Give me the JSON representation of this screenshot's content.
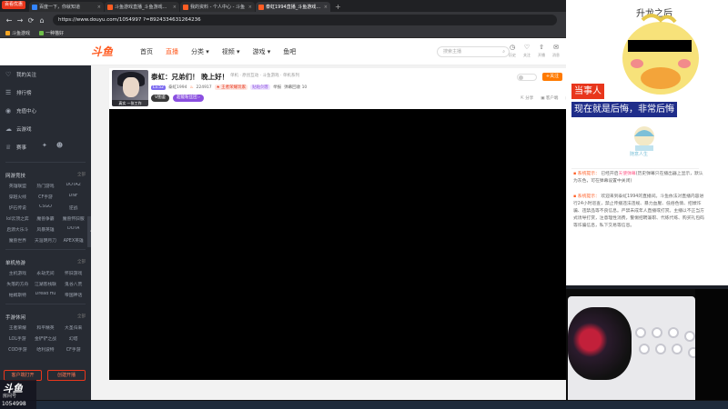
{
  "browser": {
    "badge": "百看优惠",
    "tabs": [
      {
        "label": "百度一下，你就知道",
        "color": "#3385ff",
        "active": false
      },
      {
        "label": "斗鱼游戏直播_斗鱼游戏原创",
        "color": "#ff5d23",
        "active": false
      },
      {
        "label": "我的资料 - 个人中心 - 斗鱼",
        "color": "#ff5d23",
        "active": false
      },
      {
        "label": "泰虹1994直播_斗鱼游戏原创",
        "color": "#ff5d23",
        "active": true
      }
    ],
    "new_tab": "+",
    "nav": {
      "back": "←",
      "forward": "→",
      "refresh": "⟳",
      "home": "⌂"
    },
    "url": "https://www.douyu.com/1054997 ?=8924334631264236",
    "bookmarks": [
      "斗鱼游戏",
      "一种猫好"
    ]
  },
  "site": {
    "logo": "斗鱼",
    "nav": [
      "首页",
      "直播",
      "分类 ▾",
      "视频 ▾",
      "游戏 ▾",
      "鱼吧"
    ],
    "active_nav": 1,
    "search_placeholder": "搜索主播",
    "header_icons": [
      {
        "name": "history-icon",
        "glyph": "◷",
        "label": "历史"
      },
      {
        "name": "follow-icon",
        "glyph": "♡",
        "label": "关注"
      },
      {
        "name": "upload-icon",
        "glyph": "⇧",
        "label": "开播"
      },
      {
        "name": "message-icon",
        "glyph": "✉",
        "label": "消息"
      }
    ]
  },
  "sidebar": {
    "top_items": [
      {
        "icon": "♡",
        "label": "我的关注"
      },
      {
        "icon": "☰",
        "label": "排行榜"
      },
      {
        "icon": "◉",
        "label": "充值中心"
      },
      {
        "icon": "☁",
        "label": "云游戏"
      },
      {
        "icon": "♕",
        "label": "赛事"
      }
    ],
    "sections": [
      {
        "title": "网游竞技",
        "more": "全部",
        "items": [
          "英雄联盟",
          "热门游戏",
          "DOTA2",
          "穿越火线",
          "CF手游",
          "DNF",
          "炉石传说",
          "CSGO",
          "逆战",
          "lol云顶之弈",
          "魔兽争霸",
          "魔兽怀旧服",
          "启源大乐斗",
          "风暴英雄",
          "DOTA",
          "魔兽世界",
          "天涯明月刀",
          "APEX英雄"
        ]
      },
      {
        "title": "单机热游",
        "more": "全部",
        "items": [
          "主机游戏",
          "永劫无间",
          "怀旧游戏",
          "失落的方舟",
          "江湖客栈联",
          "鬼谷八荒",
          "帕姆斯特",
          "Dread Hu",
          "帝国神话"
        ]
      },
      {
        "title": "手游休闲",
        "more": "全部",
        "items": [
          "王者荣耀",
          "和平精英",
          "大圣归来",
          "LOL手游",
          "金铲铲之战",
          "幻塔",
          "COD手游",
          "哈利波特",
          "CF手游"
        ]
      }
    ],
    "buttons": [
      "客户端打开",
      "创建开播"
    ],
    "collapse": "‹"
  },
  "room": {
    "avatar_caption": "真实 一张工作",
    "title": "泰虹：兄弟们！ 晚上好！",
    "tags": "单机 · 原创互动 · 斗鱼游戏 · 单机系列",
    "level": "Lv.52",
    "host": "泰虹1994",
    "hot": "224917",
    "badge1": "★ 王者荣耀玩家",
    "badge2": "贴贴剑客",
    "report": "举报",
    "share": "弹幕回收 10",
    "pill1": "V图鉴",
    "pill2": "超能粉丝团 ›",
    "follow": "+关注",
    "tools": [
      "⇱ 分享",
      "▣ 客户端",
      "▤ 手机看"
    ]
  },
  "overlay": {
    "meme_top": "升龙之后",
    "caption1": "当事人",
    "caption2": "现在就是后悔，非常后悔",
    "chat_logo": "随意人生",
    "messages": [
      {
        "tag": "系统提示：",
        "text": "已经开启",
        "hl": "天使弹幕",
        "rest": "(历史弹幕只在播出器上显示，默认为灰色，可在弹幕设置中关闭)"
      },
      {
        "tag": "系统提示：",
        "text": "欢迎来到泰虹1994的直播间。斗鱼依法对直播内容进行24小时巡查，禁止传播违法违规、暴力血腥、低俗色情、招嫖诈骗、违禁品等不良信息。严禁未成年人直播或打赏。主播以不正当方式诱导打赏，注意理性消费，警惕招聘兼职、代练代练、购买礼包码等诈骗信息，私下交易等信息。",
        "hl": "",
        "rest": ""
      }
    ]
  },
  "watermark": {
    "logo": "斗鱼",
    "sub": "房间号",
    "id": "1054998"
  }
}
